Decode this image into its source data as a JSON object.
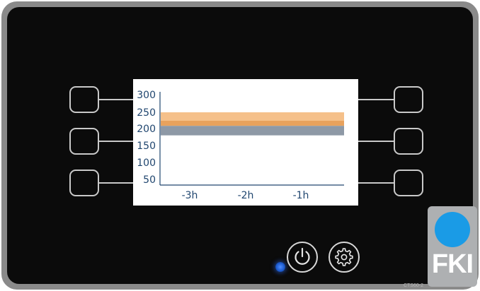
{
  "chart_data": {
    "type": "area",
    "y_ticks": [
      "300",
      "250",
      "200",
      "150",
      "100",
      "50"
    ],
    "x_ticks": [
      "-3h",
      "-2h",
      "-1h"
    ],
    "ylim": [
      50,
      300
    ],
    "bands": [
      {
        "from": 225,
        "to": 250,
        "color": "#f5c08a"
      },
      {
        "from": 210,
        "to": 225,
        "color": "#e8a25d"
      },
      {
        "from": 182,
        "to": 210,
        "color": "#8e99a6"
      }
    ]
  },
  "colors": {
    "housing": "#0a0a0a",
    "bezel": "#8c8c8c",
    "screen": "#ffffff",
    "axis_text": "#20466f",
    "led": "#2a6fe8",
    "logo_blue": "#1a9be6"
  },
  "controls": {
    "power_icon": "power-icon",
    "settings_icon": "gear-icon"
  },
  "brand": {
    "logo_text": "FKI",
    "model": "CTS60-2"
  }
}
